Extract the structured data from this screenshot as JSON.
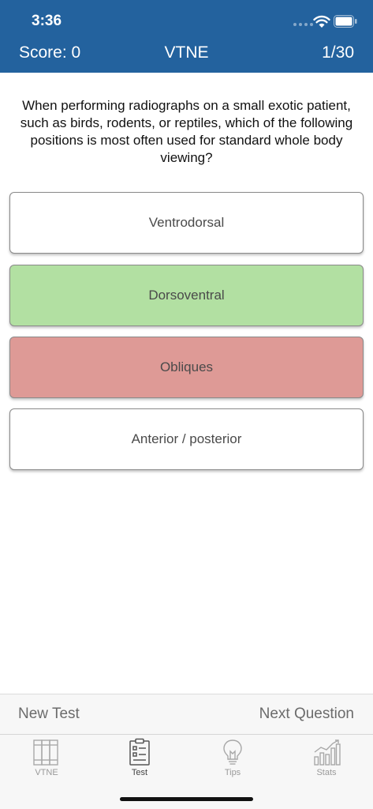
{
  "status_bar": {
    "time": "3:36"
  },
  "header": {
    "score": "Score: 0",
    "title": "VTNE",
    "progress": "1/30",
    "background_color": "#23629e"
  },
  "question": {
    "text": "When performing radiographs on a small exotic patient, such as birds, rodents, or reptiles, which of the following positions is most often used for standard whole body viewing?"
  },
  "answers": [
    {
      "label": "Ventrodorsal",
      "state": "neutral",
      "color": "#ffffff"
    },
    {
      "label": "Dorsoventral",
      "state": "correct",
      "color": "#b2e0a2"
    },
    {
      "label": "Obliques",
      "state": "incorrect",
      "color": "#de9a96"
    },
    {
      "label": "Anterior / posterior",
      "state": "neutral",
      "color": "#ffffff"
    }
  ],
  "actions": {
    "new_test": "New Test",
    "next_question": "Next Question"
  },
  "tabs": [
    {
      "label": "VTNE",
      "icon": "books-icon",
      "active": false
    },
    {
      "label": "Test",
      "icon": "clipboard-icon",
      "active": true
    },
    {
      "label": "Tips",
      "icon": "lightbulb-icon",
      "active": false
    },
    {
      "label": "Stats",
      "icon": "bar-chart-icon",
      "active": false
    }
  ]
}
